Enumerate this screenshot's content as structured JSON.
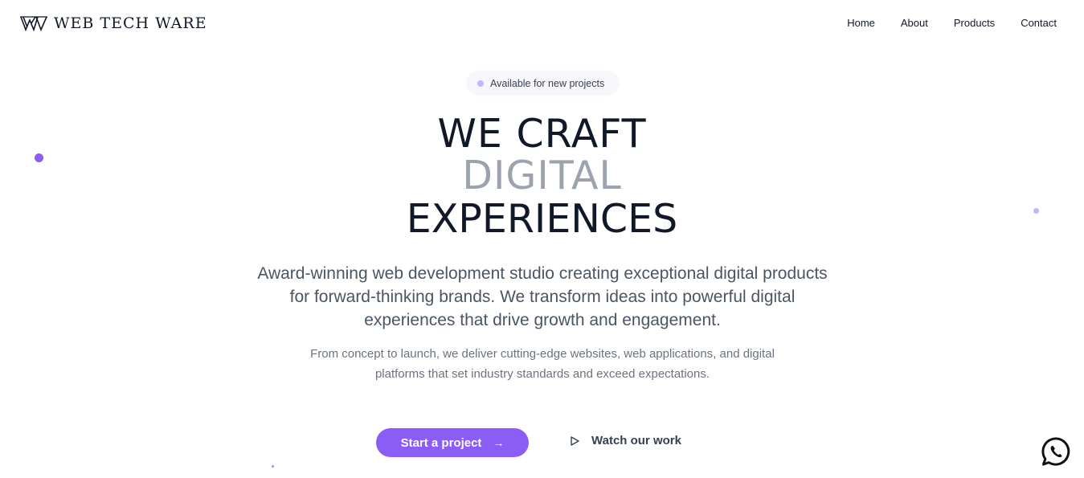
{
  "brand": {
    "name": "WEB TECH WARE",
    "logo_icon": "wtw-monogram-icon"
  },
  "nav": {
    "items": [
      {
        "label": "Home"
      },
      {
        "label": "About"
      },
      {
        "label": "Products"
      },
      {
        "label": "Contact"
      }
    ]
  },
  "hero": {
    "badge": "Available for new projects",
    "headline_line1": "WE CRAFT",
    "headline_line2": "DIGITAL",
    "headline_line3": "EXPERIENCES",
    "lead": "Award-winning web development studio creating exceptional digital products for forward-thinking brands. We transform ideas into powerful digital experiences that drive growth and engagement.",
    "sub": "From concept to launch, we deliver cutting-edge websites, web applications, and digital platforms that set industry standards and exceed expectations.",
    "primary_cta": "Start a project",
    "primary_cta_icon": "arrow-right-icon",
    "secondary_cta": "Watch our work",
    "secondary_cta_icon": "play-icon"
  },
  "floating_button_icon": "whatsapp-icon",
  "colors": {
    "accent": "#8b5cf6",
    "accent_light": "#c4b5fd",
    "text": "#111827",
    "muted": "#9ca3af"
  }
}
